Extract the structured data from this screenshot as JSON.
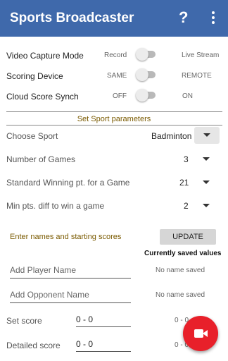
{
  "appbar": {
    "title": "Sports Broadcaster",
    "help_icon": "?",
    "more_icon": "more-vert-icon"
  },
  "modes": [
    {
      "label": "Video Capture Mode",
      "off": "Record",
      "on": "Live Stream",
      "enabled": false
    },
    {
      "label": "Scoring Device",
      "off": "SAME",
      "on": "REMOTE",
      "enabled": false
    },
    {
      "label": "Cloud Score Synch",
      "off": "OFF",
      "on": "ON",
      "enabled": false
    }
  ],
  "sport_params": {
    "section_title": "Set Sport parameters",
    "sport_label": "Choose Sport",
    "sport_value": "Badminton",
    "games_label": "Number of Games",
    "games_value": "3",
    "winpt_label": "Standard Winning pt. for a Game",
    "winpt_value": "21",
    "diff_label": "Min pts. diff to win a game",
    "diff_value": "2"
  },
  "names": {
    "hint": "Enter names and starting scores",
    "update_label": "UPDATE",
    "saved_title": "Currently saved values",
    "player_placeholder": "Add Player Name",
    "player_saved": "No name saved",
    "opponent_placeholder": "Add Opponent Name",
    "opponent_saved": "No name saved",
    "set_score_label": "Set score",
    "set_score_value": "0 - 0",
    "set_score_saved": "0 - 0",
    "detailed_score_label": "Detailed score",
    "detailed_score_value": "0 - 0",
    "detailed_score_saved": "0 - 0"
  },
  "fab": {
    "icon": "videocam-icon",
    "color": "#e8202a"
  },
  "colors": {
    "appbar": "#3f69ab",
    "accent_text": "#7a5a00"
  }
}
